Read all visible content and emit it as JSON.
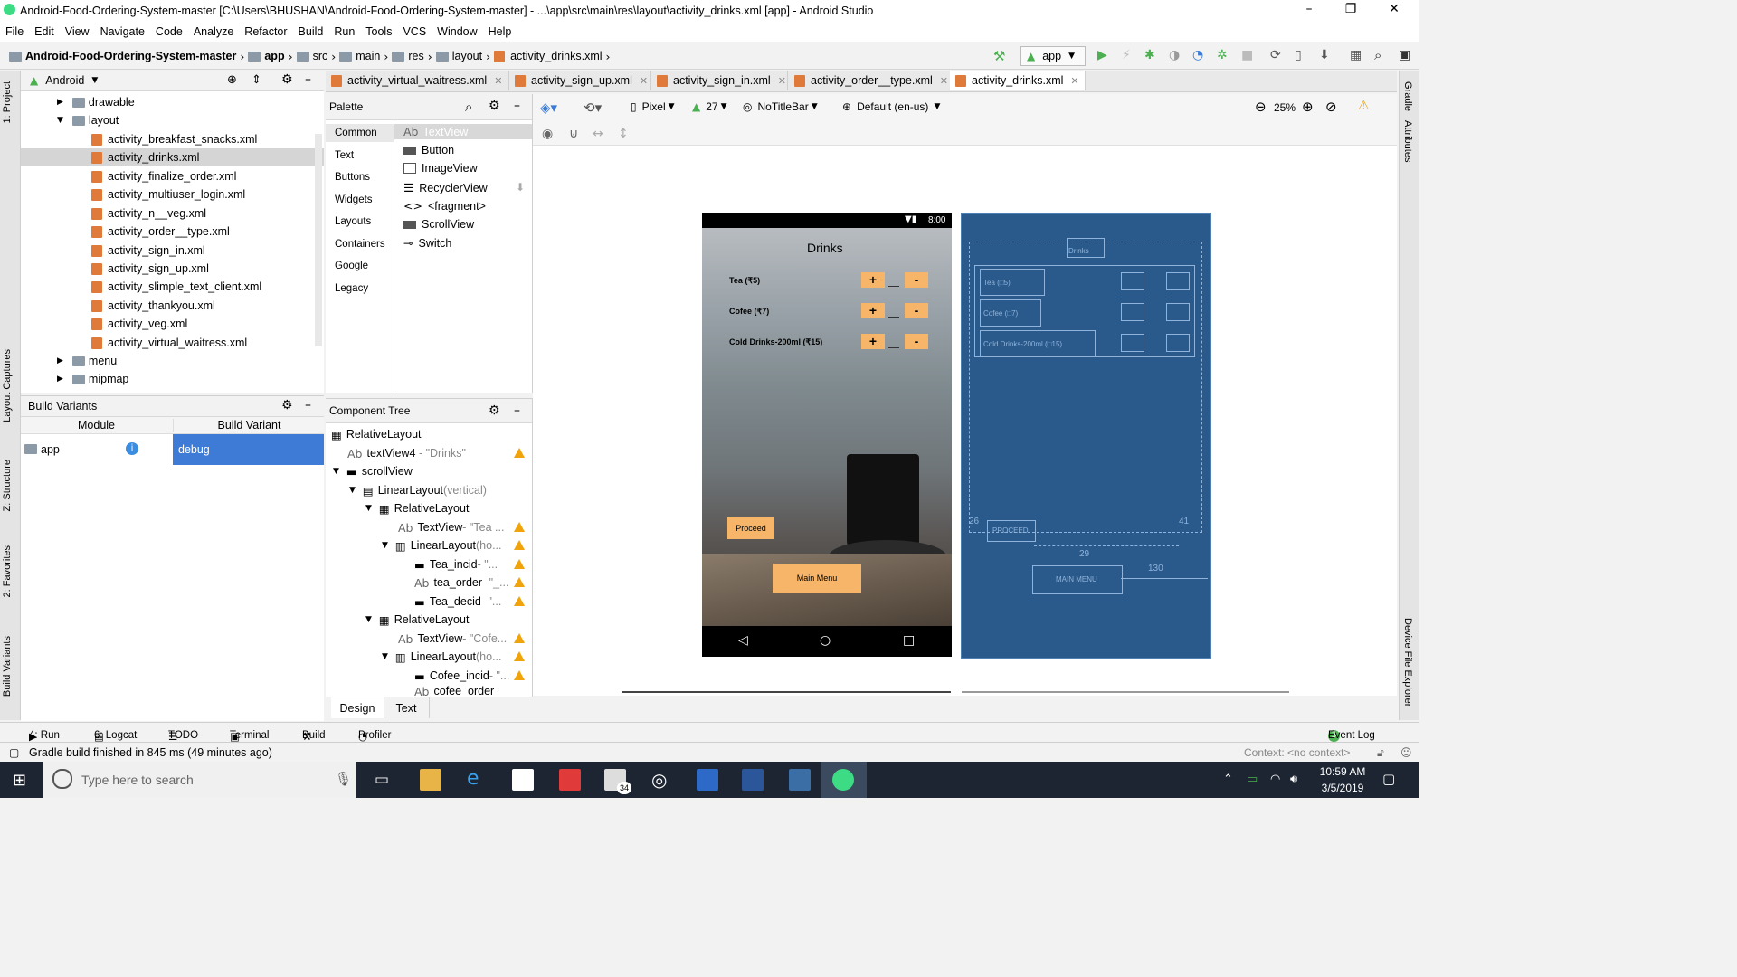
{
  "window": {
    "title": "Android-Food-Ordering-System-master [C:\\Users\\BHUSHAN\\Android-Food-Ordering-System-master] - ...\\app\\src\\main\\res\\layout\\activity_drinks.xml [app] - Android Studio"
  },
  "menu": [
    "File",
    "Edit",
    "View",
    "Navigate",
    "Code",
    "Analyze",
    "Refactor",
    "Build",
    "Run",
    "Tools",
    "VCS",
    "Window",
    "Help"
  ],
  "breadcrumb": [
    "Android-Food-Ordering-System-master",
    "app",
    "src",
    "main",
    "res",
    "layout",
    "activity_drinks.xml"
  ],
  "run_config": "app",
  "left_tabs": [
    "1: Project",
    "Layout Captures",
    "Z: Structure",
    "2: Favorites",
    "Build Variants"
  ],
  "right_tabs": [
    "Gradle",
    "Attributes",
    "Device File Explorer"
  ],
  "project": {
    "view": "Android",
    "folders": [
      "drawable",
      "layout",
      "menu",
      "mipmap"
    ],
    "files": [
      "activity_breakfast_snacks.xml",
      "activity_drinks.xml",
      "activity_finalize_order.xml",
      "activity_multiuser_login.xml",
      "activity_n__veg.xml",
      "activity_order__type.xml",
      "activity_sign_in.xml",
      "activity_sign_up.xml",
      "activity_slimple_text_client.xml",
      "activity_thankyou.xml",
      "activity_veg.xml",
      "activity_virtual_waitress.xml"
    ]
  },
  "build_variants": {
    "title": "Build Variants",
    "col_module": "Module",
    "col_variant": "Build Variant",
    "module": "app",
    "variant": "debug"
  },
  "editor_tabs": [
    "activity_virtual_waitress.xml",
    "activity_sign_up.xml",
    "activity_sign_in.xml",
    "activity_order__type.xml",
    "activity_drinks.xml"
  ],
  "palette": {
    "title": "Palette",
    "categories": [
      "Common",
      "Text",
      "Buttons",
      "Widgets",
      "Layouts",
      "Containers",
      "Google",
      "Legacy"
    ],
    "items": [
      "TextView",
      "Button",
      "ImageView",
      "RecyclerView",
      "<fragment>",
      "ScrollView",
      "Switch"
    ]
  },
  "design_toolbar": {
    "device": "Pixel",
    "api": "27",
    "theme": "NoTitleBar",
    "locale": "Default (en-us)",
    "zoom": "25%"
  },
  "component_tree": {
    "title": "Component Tree",
    "nodes": [
      {
        "label": "RelativeLayout",
        "sub": ""
      },
      {
        "label": "textView4",
        "sub": "- \"Drinks\""
      },
      {
        "label": "scrollView",
        "sub": ""
      },
      {
        "label": "LinearLayout",
        "sub": "(vertical)"
      },
      {
        "label": "RelativeLayout",
        "sub": ""
      },
      {
        "label": "TextView",
        "sub": "- \"Tea ..."
      },
      {
        "label": "LinearLayout",
        "sub": "(ho..."
      },
      {
        "label": "Tea_incid",
        "sub": "- \"..."
      },
      {
        "label": "tea_order",
        "sub": "- \"_..."
      },
      {
        "label": "Tea_decid",
        "sub": "- \"..."
      },
      {
        "label": "RelativeLayout",
        "sub": ""
      },
      {
        "label": "TextView",
        "sub": "- \"Cofe..."
      },
      {
        "label": "LinearLayout",
        "sub": "(ho..."
      },
      {
        "label": "Cofee_incid",
        "sub": "- \"..."
      },
      {
        "label": "cofee_order",
        "sub": "- \"..."
      }
    ]
  },
  "phone": {
    "time": "8:00",
    "heading": "Drinks",
    "items": [
      "Tea (₹5)",
      "Cofee (₹7)",
      "Cold Drinks-200ml (₹15)"
    ],
    "plus": "+",
    "minus": "-",
    "proceed": "Proceed",
    "main_menu": "Main Menu"
  },
  "blueprint": {
    "title": "Drinks",
    "items": [
      "Tea (□5)",
      "Cofee (□7)",
      "Cold Drinks-200ml (□15)"
    ],
    "proceed": "PROCEED",
    "main_menu": "MAIN MENU",
    "dims": [
      "26",
      "41",
      "29",
      "130"
    ]
  },
  "design_tabs": [
    "Design",
    "Text"
  ],
  "bottom_tools": [
    "4: Run",
    "6: Logcat",
    "TODO",
    "Terminal",
    "Build",
    "Profiler",
    "Event Log"
  ],
  "event_log_count": "3",
  "status": {
    "message": "Gradle build finished in 845 ms (49 minutes ago)",
    "context": "Context: <no context>"
  },
  "taskbar": {
    "search_placeholder": "Type here to search",
    "time": "10:59 AM",
    "date": "3/5/2019",
    "mail_badge": "34"
  }
}
